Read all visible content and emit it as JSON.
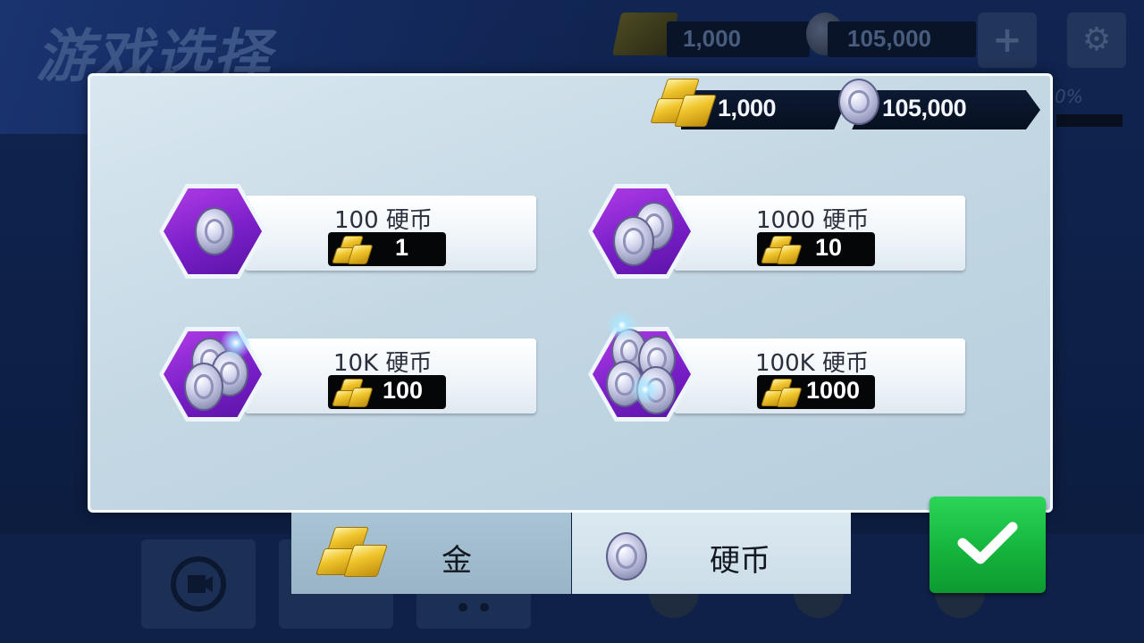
{
  "background": {
    "screen_title": "游戏选择",
    "gold_amount": "1,000",
    "coin_amount": "105,000",
    "add_symbol": "+",
    "settings_symbol": "⚙",
    "progress_text": "0%"
  },
  "wallet": {
    "gold": "1,000",
    "coins": "105,000"
  },
  "items": [
    {
      "title": "100 硬币",
      "price": "1"
    },
    {
      "title": "1000 硬币",
      "price": "10"
    },
    {
      "title": "10K 硬币",
      "price": "100"
    },
    {
      "title": "100K 硬币",
      "price": "1000"
    }
  ],
  "tabs": {
    "gold_label": "金",
    "coin_label": "硬币"
  },
  "colors": {
    "confirm": "#17b83f",
    "hex_purple": "#7a1fc9",
    "gold": "#f0c52c"
  }
}
